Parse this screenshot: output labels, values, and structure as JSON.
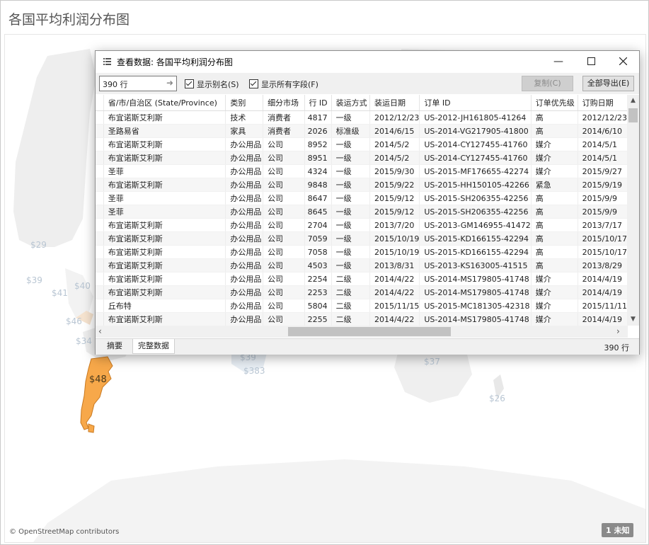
{
  "page": {
    "title": "各国平均利润分布图"
  },
  "map": {
    "attribution": "© OpenStreetMap contributors",
    "unknown_badge": "1 未知",
    "labels": [
      "$29",
      "$39",
      "$41",
      "$40",
      "$46",
      "$34",
      "$48",
      "$39",
      "$383",
      "$37",
      "$26"
    ],
    "highlight_color": "#f7a84a",
    "land_color": "#eeeeee",
    "accent_color": "#aec3d6"
  },
  "dialog": {
    "title": "查看数据: 各国平均利润分布图",
    "rows_value": "390 行",
    "show_alias": "显示别名(S)",
    "show_all_fields": "显示所有字段(F)",
    "copy": "复制(C)",
    "export_all": "全部导出(E)",
    "tabs": [
      "摘要",
      "完整数据"
    ],
    "row_count": "390 行",
    "columns": [
      "省/市/自治区 (State/Province)",
      "类别",
      "细分市场",
      "行 ID",
      "装运方式",
      "装运日期",
      "订单 ID",
      "订单优先级",
      "订购日期"
    ],
    "rows": [
      [
        "布宜诺斯艾利斯",
        "技术",
        "消费者",
        "4817",
        "一级",
        "2012/12/23",
        "US-2012-JH161805-41264",
        "高",
        "2012/12/23"
      ],
      [
        "圣路易省",
        "家具",
        "消费者",
        "2026",
        "标准级",
        "2014/6/15",
        "US-2014-VG217905-41800",
        "高",
        "2014/6/10"
      ],
      [
        "布宜诺斯艾利斯",
        "办公用品",
        "公司",
        "8952",
        "一级",
        "2014/5/2",
        "US-2014-CY127455-41760",
        "媒介",
        "2014/5/1"
      ],
      [
        "布宜诺斯艾利斯",
        "办公用品",
        "公司",
        "8951",
        "一级",
        "2014/5/2",
        "US-2014-CY127455-41760",
        "媒介",
        "2014/5/1"
      ],
      [
        "圣菲",
        "办公用品",
        "公司",
        "4324",
        "一级",
        "2015/9/30",
        "US-2015-MF176655-42274",
        "媒介",
        "2015/9/27"
      ],
      [
        "布宜诺斯艾利斯",
        "办公用品",
        "公司",
        "9848",
        "一级",
        "2015/9/22",
        "US-2015-HH150105-42266",
        "紧急",
        "2015/9/19"
      ],
      [
        "圣菲",
        "办公用品",
        "公司",
        "8647",
        "一级",
        "2015/9/12",
        "US-2015-SH206355-42256",
        "高",
        "2015/9/9"
      ],
      [
        "圣菲",
        "办公用品",
        "公司",
        "8645",
        "一级",
        "2015/9/12",
        "US-2015-SH206355-42256",
        "高",
        "2015/9/9"
      ],
      [
        "布宜诺斯艾利斯",
        "办公用品",
        "公司",
        "2704",
        "一级",
        "2013/7/20",
        "US-2013-GM146955-41472",
        "高",
        "2013/7/17"
      ],
      [
        "布宜诺斯艾利斯",
        "办公用品",
        "公司",
        "7059",
        "一级",
        "2015/10/19",
        "US-2015-KD166155-42294",
        "高",
        "2015/10/17"
      ],
      [
        "布宜诺斯艾利斯",
        "办公用品",
        "公司",
        "7058",
        "一级",
        "2015/10/19",
        "US-2015-KD166155-42294",
        "高",
        "2015/10/17"
      ],
      [
        "布宜诺斯艾利斯",
        "办公用品",
        "公司",
        "4503",
        "一级",
        "2013/8/31",
        "US-2013-KS163005-41515",
        "高",
        "2013/8/29"
      ],
      [
        "布宜诺斯艾利斯",
        "办公用品",
        "公司",
        "2254",
        "二级",
        "2014/4/22",
        "US-2014-MS179805-41748",
        "媒介",
        "2014/4/19"
      ],
      [
        "布宜诺斯艾利斯",
        "办公用品",
        "公司",
        "2253",
        "二级",
        "2014/4/22",
        "US-2014-MS179805-41748",
        "媒介",
        "2014/4/19"
      ],
      [
        "丘布特",
        "办公用品",
        "公司",
        "5804",
        "二级",
        "2015/11/15",
        "US-2015-MC181305-42318",
        "媒介",
        "2015/11/11"
      ],
      [
        "布宜诺斯艾利斯",
        "办公用品",
        "公司",
        "2255",
        "二级",
        "2014/4/22",
        "US-2014-MS179805-41748",
        "媒介",
        "2014/4/19"
      ]
    ]
  }
}
